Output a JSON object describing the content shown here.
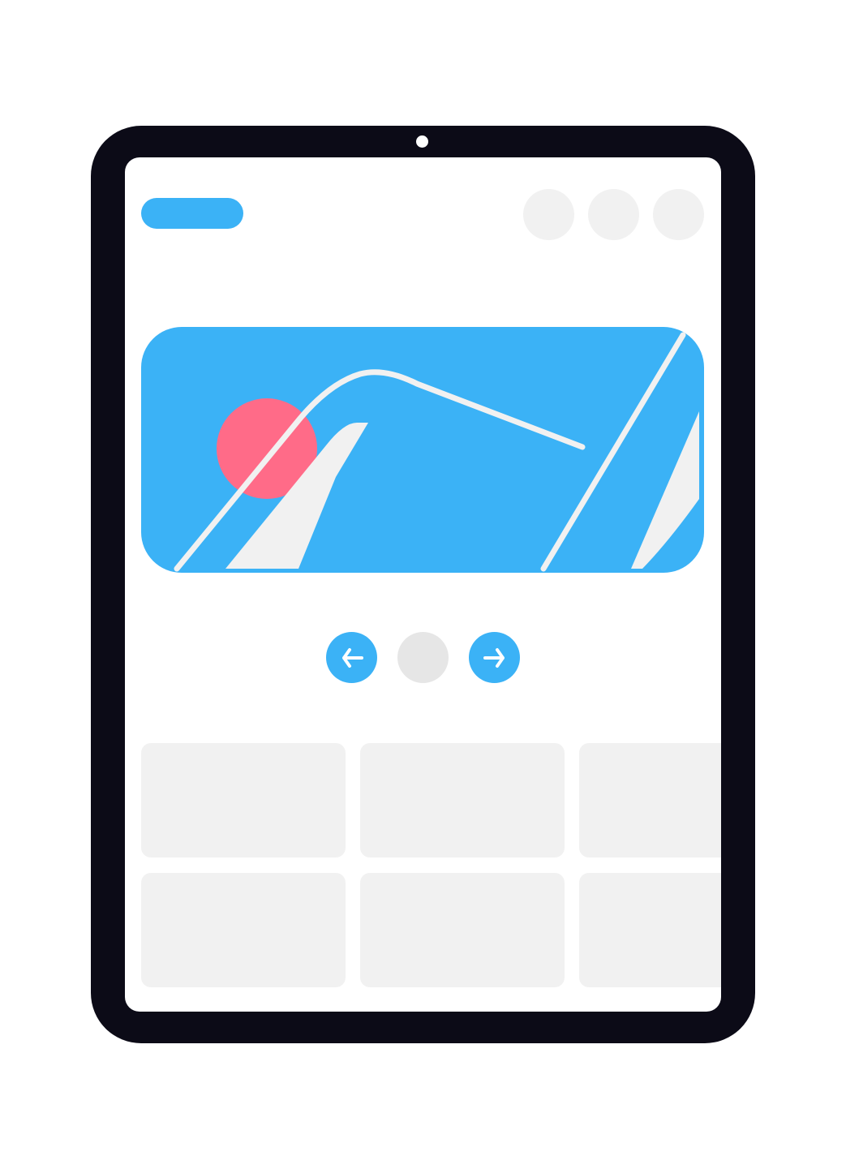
{
  "device": {
    "frame_color": "#0c0b17",
    "camera": "front-camera"
  },
  "header": {
    "logo": "logo-pill",
    "icons": [
      "placeholder-icon",
      "placeholder-icon",
      "placeholder-icon"
    ]
  },
  "hero": {
    "background_color": "#3bb2f6",
    "accent_color": "#ff6b88",
    "line_color": "#f1f1f1",
    "illustration": "abstract-slide-illustration"
  },
  "pager": {
    "prev_icon": "arrow-left-icon",
    "next_icon": "arrow-right-icon",
    "active_color": "#3bb2f6",
    "inactive_color": "#e6e6e6"
  },
  "cards": {
    "count": 6,
    "color": "#f1f1f1"
  }
}
